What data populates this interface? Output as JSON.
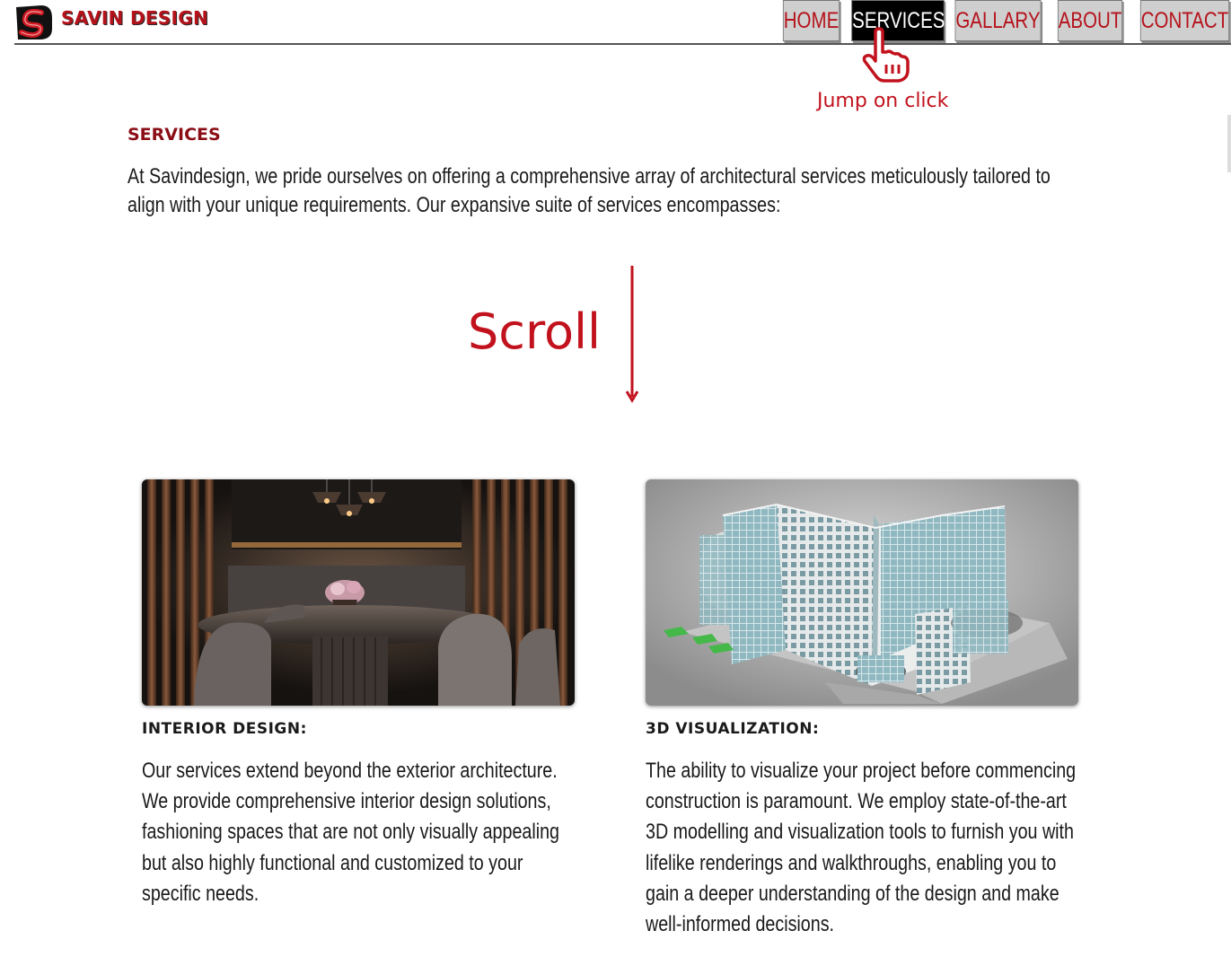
{
  "brand": {
    "name": "SAVIN DESIGN",
    "logo_letters": "SD"
  },
  "nav": {
    "items": [
      {
        "label": "HOME"
      },
      {
        "label": "SERVICES"
      },
      {
        "label": "GALLARY"
      },
      {
        "label": "ABOUT"
      },
      {
        "label": "CONTACT"
      }
    ],
    "active": "SERVICES"
  },
  "annotations": {
    "click_note": "Jump on click",
    "scroll_note": "Scroll",
    "color": "#c2121d"
  },
  "section": {
    "title": "SERVICES",
    "intro": "At Savindesign, we pride ourselves on offering a comprehensive array of architectural services meticulously tailored to align with your unique requirements. Our expansive suite of services encompasses:"
  },
  "services": [
    {
      "title": "INTERIOR DESIGN:",
      "text": "Our services extend beyond the exterior architecture. We provide comprehensive interior design solutions, fashioning spaces that are not only visually appealing but also highly functional and customized to your specific needs.",
      "image": "dining-room-render"
    },
    {
      "title": "3D VISUALIZATION:",
      "text": "The ability to visualize your project before commencing construction is paramount. We employ state-of-the-art 3D modelling and visualization tools to furnish you with lifelike renderings and walkthroughs, enabling you to gain a deeper understanding of the design and make well-informed decisions.",
      "image": "office-building-render"
    }
  ],
  "colors": {
    "brand_red": "#b5121b",
    "title_red": "#8b0d16",
    "nav_bg": "#cfcfcf",
    "nav_active_bg": "#000000"
  }
}
